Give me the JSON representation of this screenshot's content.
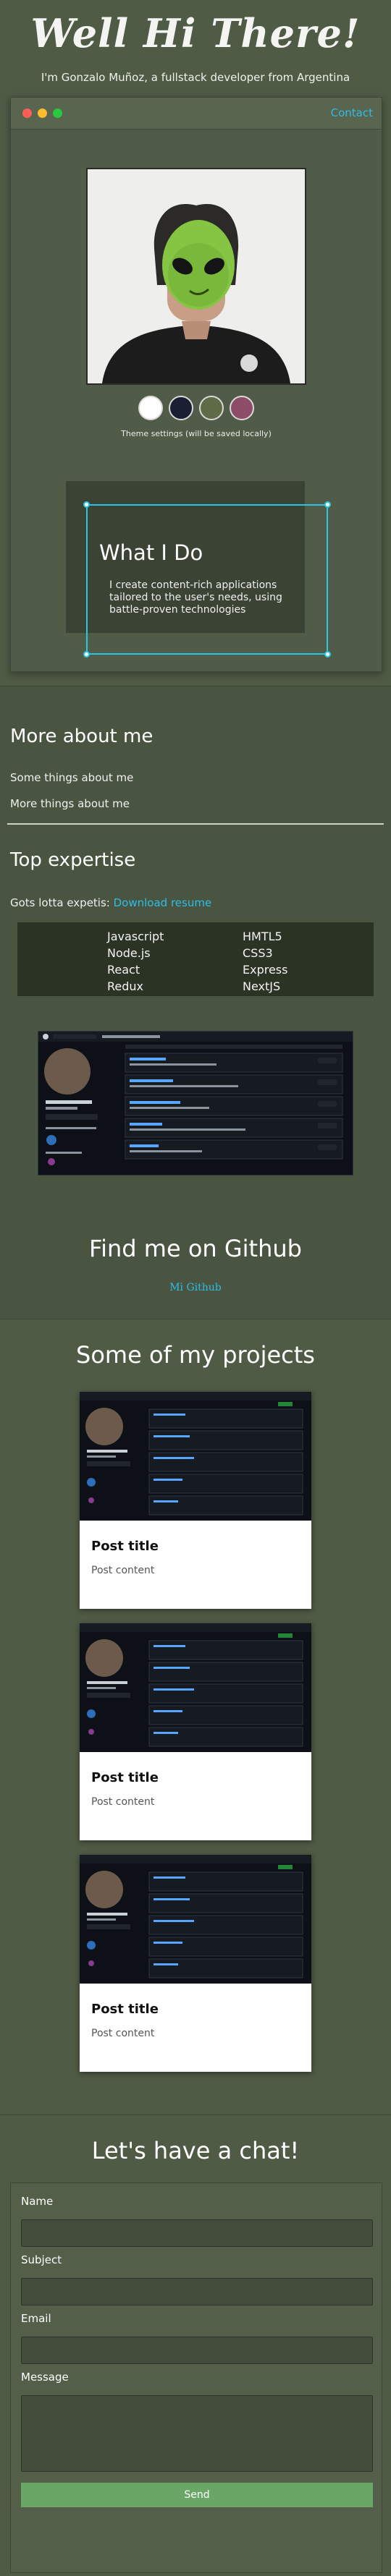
{
  "hero": {
    "title": "Well Hi There!",
    "subtitle": "I'm Gonzalo Muñoz, a fullstack developer from Argentina"
  },
  "window": {
    "contact_label": "Contact",
    "theme_note": "Theme settings (will be saved locally)",
    "theme_colors": [
      "#ffffff",
      "#1b1f33",
      "#5f6b46",
      "#8d4d68"
    ]
  },
  "whatido": {
    "title": "What I Do",
    "text": "I create content-rich applications tailored to the user's needs, using battle-proven technologies"
  },
  "about": {
    "title": "More about me",
    "line1": "Some things about me",
    "line2": "More things about me",
    "expertise_title": "Top expertise",
    "expertise_text": "Gots lotta expetis: ",
    "resume_label": "Download resume",
    "skills_left": [
      "Javascript",
      "Node.js",
      "React",
      "Redux"
    ],
    "skills_right": [
      "HMTL5",
      "CSS3",
      "Express",
      "NextJS"
    ],
    "github_title": "Find me on Github",
    "github_link": "Mi Github"
  },
  "projects": {
    "title": "Some of my projects",
    "cards": [
      {
        "title": "Post title",
        "content": "Post content"
      },
      {
        "title": "Post title",
        "content": "Post content"
      },
      {
        "title": "Post title",
        "content": "Post content"
      }
    ]
  },
  "chat": {
    "title": "Let's have a chat!",
    "name_label": "Name",
    "subject_label": "Subject",
    "email_label": "Email",
    "message_label": "Message",
    "send_label": "Send"
  },
  "colors": {
    "background": "#4f5b45",
    "accent_link": "#2dbde6",
    "send_button": "#6aa766"
  }
}
